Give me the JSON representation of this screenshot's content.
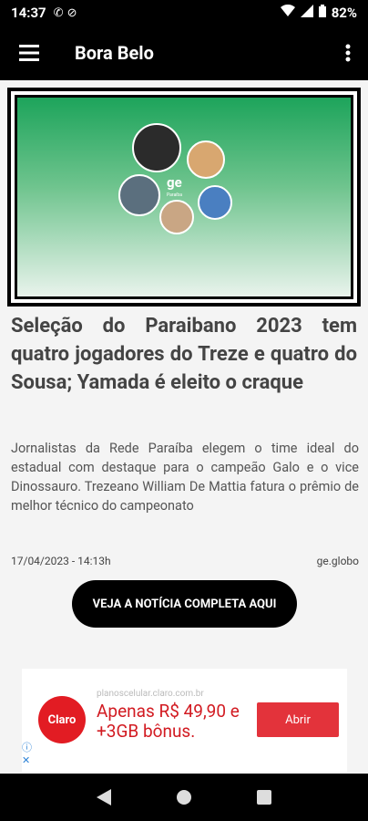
{
  "status_bar": {
    "time": "14:37",
    "battery": "82%"
  },
  "app_bar": {
    "title": "Bora Belo"
  },
  "article": {
    "headline": "Seleção do Paraibano 2023 tem quatro jogadores do Treze e quatro do Sousa; Yamada é eleito o craque",
    "summary": "Jornalistas da Rede Paraíba elegem o time ideal do estadual com destaque para o campeão Galo e o vice Dinossauro. Trezeano William De Mattia fatura o prêmio de melhor técnico do campeonato",
    "date": "17/04/2023 - 14:13h",
    "source": "ge.globo",
    "cta_label": "VEJA A NOTÍCIA COMPLETA AQUI",
    "image_brand": "ge",
    "image_brand_sub": "Paraíba"
  },
  "ad": {
    "logo_text": "Claro",
    "url": "planoscelular.claro.com.br",
    "offer": "Apenas R$ 49,90 e +3GB bônus.",
    "button_label": "Abrir"
  },
  "colors": {
    "app_bar": "#000000",
    "hero_green": "#1da45b",
    "ad_red": "#d21b22"
  }
}
